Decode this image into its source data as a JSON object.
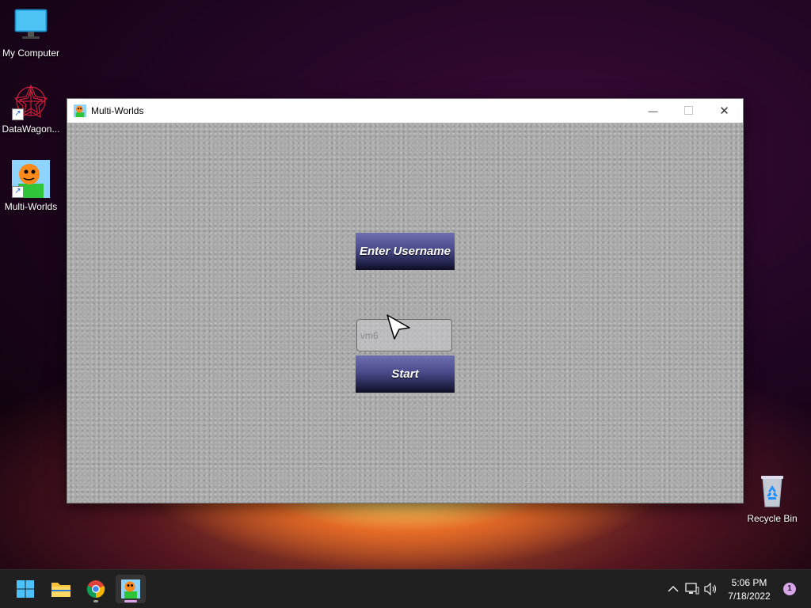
{
  "desktop": {
    "icons": [
      {
        "label": "My Computer",
        "icon": "monitor-icon"
      },
      {
        "label": "DataWagon...",
        "icon": "datawagon-logo-icon"
      },
      {
        "label": "Multi-Worlds",
        "icon": "multiworlds-character-icon"
      },
      {
        "label": "Recycle Bin",
        "icon": "recycle-bin-icon"
      }
    ]
  },
  "window": {
    "title": "Multi-Worlds",
    "icon": "multiworlds-character-icon",
    "controls": {
      "minimize": "—",
      "maximize": "☐",
      "close": "✕"
    },
    "enter_username_label": "Enter Username",
    "username_value": "vm6",
    "start_label": "Start"
  },
  "taskbar": {
    "items": [
      {
        "name": "start",
        "icon": "windows-start-icon"
      },
      {
        "name": "file-explorer",
        "icon": "folder-icon"
      },
      {
        "name": "chrome",
        "icon": "chrome-icon"
      },
      {
        "name": "multi-worlds",
        "icon": "multiworlds-character-icon",
        "active": true
      }
    ],
    "tray": {
      "chevron": "^",
      "time": "5:06 PM",
      "date": "7/18/2022",
      "notifications": "1"
    }
  },
  "colors": {
    "button_top": "#6e6fae",
    "button_bottom": "#0d0d22",
    "window_bg": "#a8a8a8",
    "taskbar_bg": "#202020",
    "accent": "#d8a5e6"
  }
}
